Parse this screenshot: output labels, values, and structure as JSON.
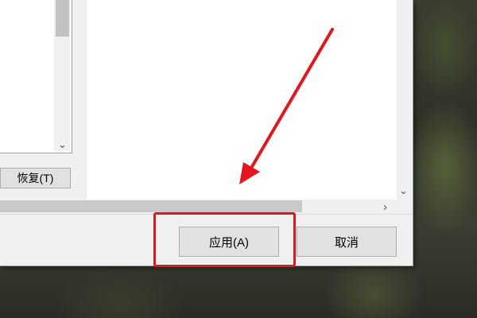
{
  "dialog": {
    "restore_label": "恢复(T)",
    "apply_label": "应用(A)",
    "cancel_label": "取消"
  },
  "icons": {
    "left_scroll_down": "chevron-down-icon",
    "right_scroll_down": "chevron-down-icon",
    "hscroll_right": "chevron-right-icon"
  },
  "annotation": {
    "color": "#e8141c",
    "target": "apply-button"
  }
}
